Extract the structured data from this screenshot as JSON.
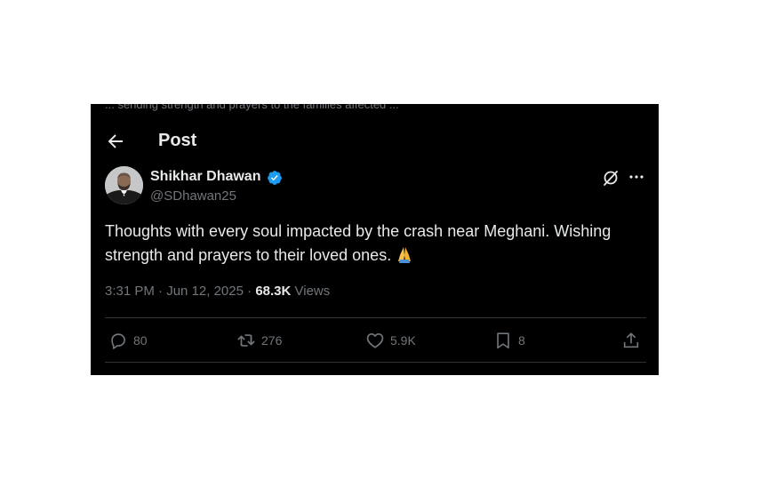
{
  "previous_line_fragment": "... sending strength and prayers to the families affected ...",
  "header": {
    "title": "Post"
  },
  "author": {
    "name": "Shikhar Dhawan",
    "handle": "@SDhawan25",
    "verified": true
  },
  "tweet": {
    "text": "Thoughts with every soul impacted by the crash near Meghani. Wishing strength and prayers to their loved ones.",
    "emoji": "🙏"
  },
  "meta": {
    "time": "3:31 PM",
    "separator": "·",
    "date": "Jun 12, 2025",
    "views_count": "68.3K",
    "views_label": "Views"
  },
  "actions": {
    "replies": "80",
    "reposts": "276",
    "likes": "5.9K",
    "bookmarks": "8"
  },
  "colors": {
    "background": "#000000",
    "text_primary": "#e7e9ea",
    "text_secondary": "#71767b",
    "divider": "#2f3336",
    "verified_badge": "#1d9bf0"
  },
  "icons": {
    "back": "arrow-left-icon",
    "verified": "verified-badge-icon",
    "grok": "grok-icon",
    "more": "more-horizontal-icon",
    "reply": "reply-icon",
    "repost": "repost-icon",
    "like": "heart-icon",
    "bookmark": "bookmark-icon",
    "share": "share-icon"
  }
}
